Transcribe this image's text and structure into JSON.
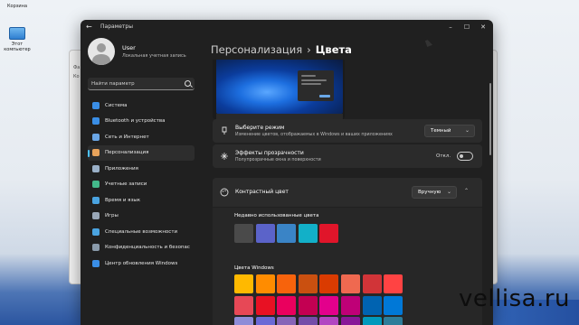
{
  "desktop": {
    "icons": [
      {
        "label": "Корзина"
      },
      {
        "label": "Этот компьютер"
      }
    ],
    "watermark": "vellisa.ru"
  },
  "background_window": {
    "rows": [
      "Фа",
      "Ко"
    ]
  },
  "window": {
    "title": "Параметры",
    "controls": {
      "minimize": "–",
      "maximize": "☐",
      "close": "✕"
    }
  },
  "profile": {
    "name": "User",
    "subtitle": "Локальная учетная запись"
  },
  "search": {
    "placeholder": "Найти параметр"
  },
  "sidebar": {
    "items": [
      {
        "label": "Система",
        "icon": "system-icon",
        "color": "#3a8ee6"
      },
      {
        "label": "Bluetooth и устройства",
        "icon": "bluetooth-icon",
        "color": "#3a8ee6"
      },
      {
        "label": "Сеть и Интернет",
        "icon": "network-icon",
        "color": "#6aa6e6"
      },
      {
        "label": "Персонализация",
        "icon": "brush-icon",
        "color": "#e8a25a",
        "active": true
      },
      {
        "label": "Приложения",
        "icon": "apps-icon",
        "color": "#9ab0c8"
      },
      {
        "label": "Учетные записи",
        "icon": "accounts-icon",
        "color": "#43b98a"
      },
      {
        "label": "Время и язык",
        "icon": "time-language-icon",
        "color": "#4aa3e0"
      },
      {
        "label": "Игры",
        "icon": "gaming-icon",
        "color": "#9aa8b8"
      },
      {
        "label": "Специальные возможности",
        "icon": "accessibility-icon",
        "color": "#4aa3e0"
      },
      {
        "label": "Конфиденциальность и безопас",
        "icon": "shield-icon",
        "color": "#8a9aaa"
      },
      {
        "label": "Центр обновления Windows",
        "icon": "update-icon",
        "color": "#3a8ee6"
      }
    ]
  },
  "header": {
    "parent": "Персонализация",
    "separator": "›",
    "current": "Цвета"
  },
  "mode": {
    "title": "Выберите режим",
    "description": "Изменение цветов, отображаемых в Windows и ваших приложениях",
    "value": "Темный",
    "chevron": "⌄"
  },
  "transparency": {
    "title": "Эффекты прозрачности",
    "description": "Полупрозрачные окна и поверхности",
    "state_label": "Откл.",
    "on": false
  },
  "accent": {
    "title": "Контрастный цвет",
    "value": "Вручную",
    "chevron": "⌄",
    "collapse": "⌃",
    "recent_label": "Недавно использованные цвета",
    "recent": [
      "#4a4a4a",
      "#5b63c9",
      "#3a84c6",
      "#12b0c8",
      "#e0152a"
    ],
    "windows_label": "Цвета Windows",
    "windows_colors": [
      [
        "#ffb900",
        "#ff8c00",
        "#f7630c",
        "#ca5010",
        "#da3b01",
        "#ef6950",
        "#d13438",
        "#ff4343"
      ],
      [
        "#e74856",
        "#e81123",
        "#ea005e",
        "#c30052",
        "#e3008c",
        "#bf0077",
        "#0063b1",
        "#0078d7"
      ],
      [
        "#8e8cd8",
        "#6b69d6",
        "#8764b8",
        "#744da9",
        "#b146c2",
        "#881798",
        "#0099bc",
        "#2d7d9a"
      ]
    ]
  }
}
